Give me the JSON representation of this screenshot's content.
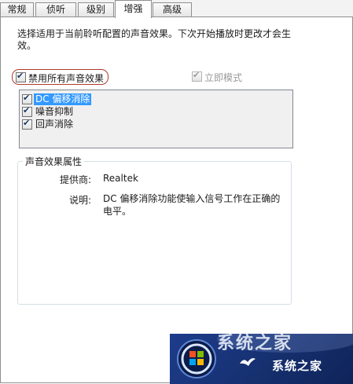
{
  "tabs": [
    {
      "label": "常规",
      "active": false
    },
    {
      "label": "侦听",
      "active": false
    },
    {
      "label": "级别",
      "active": false
    },
    {
      "label": "增强",
      "active": true
    },
    {
      "label": "高级",
      "active": false
    }
  ],
  "enhancements": {
    "description": "选择适用于当前聆听配置的声音效果。下次开始播放时更改才会生效。",
    "disable_all": {
      "label": "禁用所有声音效果",
      "checked": true
    },
    "immediate_mode": {
      "label": "立即模式",
      "checked": true,
      "enabled": false
    },
    "effects": [
      {
        "label": "DC 偏移消除",
        "checked": true,
        "selected": true
      },
      {
        "label": "噪音抑制",
        "checked": true,
        "selected": false
      },
      {
        "label": "回声消除",
        "checked": true,
        "selected": false
      }
    ],
    "properties": {
      "title": "声音效果属性",
      "provider_label": "提供商:",
      "provider_value": "Realtek",
      "explanation_label": "说明:",
      "explanation_value": "DC 偏移消除功能使输入信号工作在正确的电平。"
    }
  },
  "watermark": {
    "top_text": "系统之家",
    "text": "系统之家",
    "logo_icon": "windows-logo-icon",
    "colors": {
      "background": "#1e3c8c",
      "text": "#ffffff"
    }
  }
}
